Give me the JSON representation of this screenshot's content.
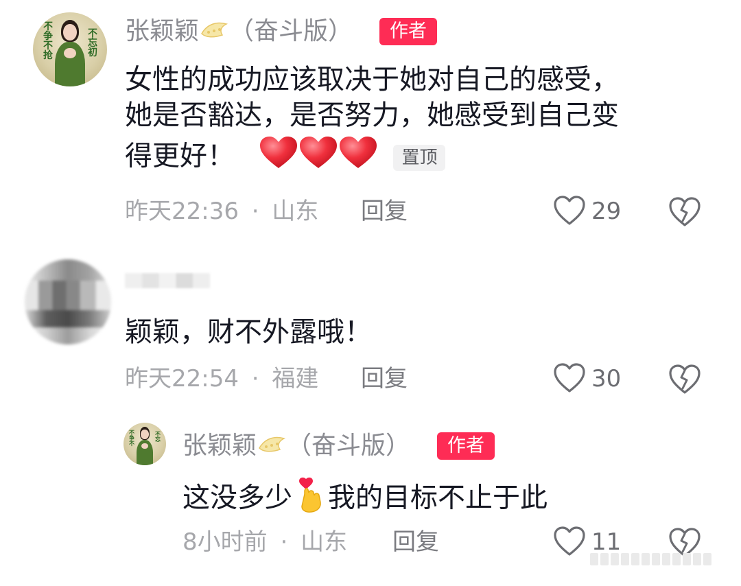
{
  "colors": {
    "author_badge_bg": "#fe2c55",
    "username": "#8a8b91",
    "meta": "#a6a7ab",
    "text": "#161823"
  },
  "comments": [
    {
      "username": "张颖颖",
      "username_suffix": "（奋斗版）",
      "username_emoji": "crown-icon",
      "author_badge": "作者",
      "lines": [
        "女性的成功应该取决于她对自己的感受，",
        "她是否豁达，是否努力，她感受到自己变",
        "得更好！"
      ],
      "emoji": [
        "heart-icon",
        "heart-icon",
        "heart-icon"
      ],
      "pin_label": "置顶",
      "time": "昨天22:36",
      "location": "山东",
      "reply_label": "回复",
      "likes": "29"
    },
    {
      "username": "",
      "text": "颖颖，财不外露哦！",
      "time": "昨天22:54",
      "location": "福建",
      "reply_label": "回复",
      "likes": "30"
    }
  ],
  "reply": {
    "username": "张颖颖",
    "username_suffix": "（奋斗版）",
    "username_emoji": "crown-icon",
    "author_badge": "作者",
    "text_before": "这没多少",
    "emoji": "finger-heart-icon",
    "text_after": "我的目标不止于此",
    "time": "8小时前",
    "location": "山东",
    "reply_label": "回复",
    "likes": "11"
  },
  "separator": "·"
}
